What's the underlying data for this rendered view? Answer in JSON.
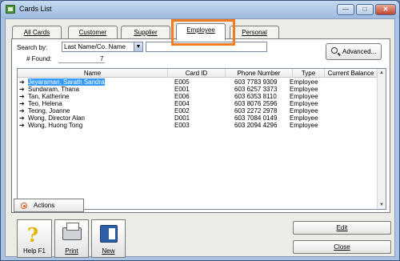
{
  "window": {
    "title": "Cards List"
  },
  "tabs": [
    {
      "label": "All Cards"
    },
    {
      "label": "Customer"
    },
    {
      "label": "Supplier"
    },
    {
      "label": "Employee"
    },
    {
      "label": "Personal"
    }
  ],
  "search": {
    "label": "Search by:",
    "field_value": "Last Name/Co. Name",
    "query": "",
    "found_label": "# Found:",
    "found_count": "7",
    "advanced_label": "Advanced..."
  },
  "columns": [
    "Name",
    "Card ID",
    "Phone Number",
    "Type",
    "Current Balance"
  ],
  "rows": [
    {
      "name": "Jeyaraman, Sarath Sandra",
      "card_id": "E005",
      "phone": "603 7783 9309",
      "type": "Employee",
      "balance": ""
    },
    {
      "name": "Sundaram, Thana",
      "card_id": "E001",
      "phone": "603 6257 3373",
      "type": "Employee",
      "balance": ""
    },
    {
      "name": "Tan, Katherine",
      "card_id": "E006",
      "phone": "603 6353 8110",
      "type": "Employee",
      "balance": ""
    },
    {
      "name": "Teo, Helena",
      "card_id": "E004",
      "phone": "603 8076 2596",
      "type": "Employee",
      "balance": ""
    },
    {
      "name": "Teong, Joanne",
      "card_id": "E002",
      "phone": "603 2272 2978",
      "type": "Employee",
      "balance": ""
    },
    {
      "name": "Wong, Director Alan",
      "card_id": "D001",
      "phone": "603 7084 0149",
      "type": "Employee",
      "balance": ""
    },
    {
      "name": "Wong, Huong Tong",
      "card_id": "E003",
      "phone": "603 2094 4296",
      "type": "Employee",
      "balance": ""
    }
  ],
  "actions": {
    "label": "Actions"
  },
  "toolbar": {
    "help_label": "Help F1",
    "print_label": "Print",
    "new_label": "New"
  },
  "buttons": {
    "edit": "Edit",
    "close": "Close"
  },
  "colors": {
    "highlight": "#f47c20",
    "selection": "#3399ff"
  },
  "icons": [
    "app-icon",
    "minimize-icon",
    "maximize-icon",
    "close-icon",
    "magnifier-icon",
    "arrow-right-icon",
    "actions-icon",
    "help-icon",
    "printer-icon",
    "new-card-icon"
  ]
}
